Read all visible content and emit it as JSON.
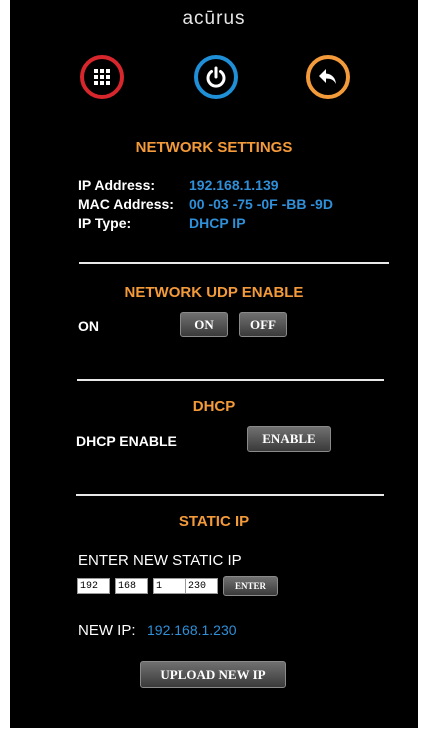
{
  "brand": "acūrus",
  "nav": {
    "menu_icon": "grid-menu-icon",
    "power_icon": "power-icon",
    "back_icon": "back-arrow-icon",
    "colors": {
      "menu": "#d8262d",
      "power": "#1f8fd8",
      "back": "#f39a3a"
    }
  },
  "network_settings": {
    "title": "NETWORK SETTINGS",
    "ip_address_label": "IP Address:",
    "ip_address_value": "192.168.1.139",
    "mac_label": "MAC Address:",
    "mac_value": "00 -03 -75 -0F -BB -9D",
    "ip_type_label": "IP Type:",
    "ip_type_value": "DHCP IP"
  },
  "udp": {
    "title": "NETWORK UDP ENABLE",
    "status": "ON",
    "on_label": "ON",
    "off_label": "OFF"
  },
  "dhcp": {
    "title": "DHCP",
    "label": "DHCP ENABLE",
    "button": "ENABLE"
  },
  "static_ip": {
    "title": "STATIC IP",
    "prompt": "ENTER NEW STATIC IP",
    "octets": [
      "192",
      "168",
      "1",
      "230"
    ],
    "enter_label": "ENTER",
    "new_ip_label": "NEW IP:",
    "new_ip_value": "192.168.1.230",
    "upload_label": "UPLOAD NEW IP"
  }
}
